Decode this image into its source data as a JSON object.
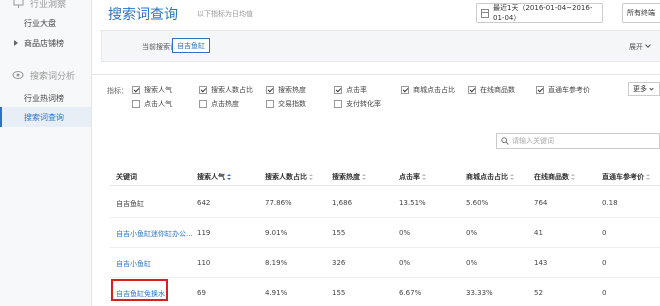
{
  "sidebar": {
    "section1": "行业洞察",
    "items1": [
      {
        "label": "行业大盘"
      },
      {
        "label": "商品店铺榜"
      }
    ],
    "section2": "搜索词分析",
    "items2": [
      {
        "label": "行业热词榜"
      },
      {
        "label": "搜索词查询"
      }
    ]
  },
  "header": {
    "title": "搜索词查询",
    "subtitle": "以下指标为日均值",
    "date_range": "最近1天（2016-01-04~2016-01-04）",
    "terminal": "所有终端"
  },
  "keyword_panel": {
    "label": "当前搜索词：",
    "tag": "自吉鱼缸",
    "expand": "展开"
  },
  "indicators": {
    "label": "指标：",
    "more": "更多",
    "row1": [
      {
        "label": "搜索人气",
        "checked": true
      },
      {
        "label": "搜索人数占比",
        "checked": true
      },
      {
        "label": "搜索热度",
        "checked": true
      },
      {
        "label": "点击率",
        "checked": true
      },
      {
        "label": "商城点击占比",
        "checked": true
      },
      {
        "label": "在线商品数",
        "checked": true
      },
      {
        "label": "直通车参考价",
        "checked": true
      }
    ],
    "row2": [
      {
        "label": "点击人气",
        "checked": false
      },
      {
        "label": "点击热度",
        "checked": false
      },
      {
        "label": "交易指数",
        "checked": false
      },
      {
        "label": "支付转化率",
        "checked": false
      }
    ]
  },
  "search": {
    "placeholder": "请输入关键词"
  },
  "table": {
    "headers": [
      "关键词",
      "搜索人气",
      "搜索人数占比",
      "搜索热度",
      "点击率",
      "商城点击占比",
      "在线商品数",
      "直通车参考价"
    ],
    "rows": [
      [
        "自吉鱼缸",
        "642",
        "77.86%",
        "1,686",
        "13.51%",
        "5.60%",
        "764",
        "0.18"
      ],
      [
        "自吉小鱼缸迷你缸办公...",
        "119",
        "9.01%",
        "155",
        "0%",
        "0%",
        "41",
        "0"
      ],
      [
        "自吉小鱼缸",
        "110",
        "8.19%",
        "326",
        "0%",
        "0%",
        "143",
        "0"
      ],
      [
        "自吉鱼缸免换水",
        "69",
        "4.91%",
        "155",
        "6.67%",
        "33.33%",
        "52",
        "0"
      ]
    ]
  },
  "colors": {
    "accent": "#2b73c7",
    "highlight": "#d9201f"
  }
}
